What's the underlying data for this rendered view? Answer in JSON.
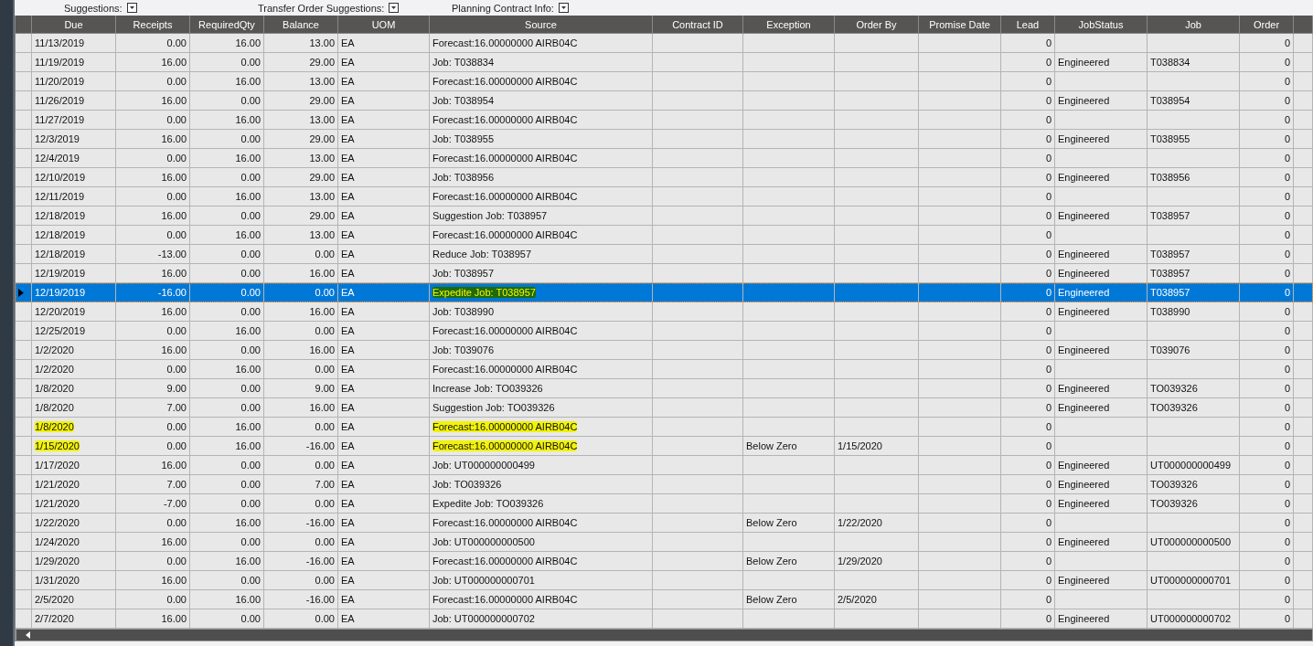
{
  "top_bar": [
    {
      "label": "Suggestions:"
    },
    {
      "label": "Transfer Order Suggestions:"
    },
    {
      "label": "Planning Contract Info:"
    }
  ],
  "table": {
    "columns": [
      {
        "label": "Due",
        "kind": "text"
      },
      {
        "label": "Receipts",
        "kind": "number"
      },
      {
        "label": "RequiredQty",
        "kind": "number"
      },
      {
        "label": "Balance",
        "kind": "number"
      },
      {
        "label": "UOM",
        "kind": "text"
      },
      {
        "label": "Source",
        "kind": "text"
      },
      {
        "label": "Contract ID",
        "kind": "text"
      },
      {
        "label": "Exception",
        "kind": "text"
      },
      {
        "label": "Order By",
        "kind": "text"
      },
      {
        "label": "Promise Date",
        "kind": "text"
      },
      {
        "label": "Lead",
        "kind": "number"
      },
      {
        "label": "JobStatus",
        "kind": "text"
      },
      {
        "label": "Job",
        "kind": "text"
      },
      {
        "label": "Order",
        "kind": "number"
      }
    ],
    "rows": [
      {
        "selected": false,
        "due_marked": false,
        "source_marked": false,
        "due": "11/13/2019",
        "receipts": "0.00",
        "required_qty": "16.00",
        "balance": "13.00",
        "uom": "EA",
        "source": "Forecast:16.00000000 AIRB04C",
        "lead": "0",
        "order": "0"
      },
      {
        "selected": false,
        "due_marked": false,
        "source_marked": false,
        "due": "11/19/2019",
        "receipts": "16.00",
        "required_qty": "0.00",
        "balance": "29.00",
        "uom": "EA",
        "source": "Job: T038834",
        "lead": "0",
        "job_status": "Engineered",
        "job": "T038834",
        "order": "0"
      },
      {
        "selected": false,
        "due_marked": false,
        "source_marked": false,
        "due": "11/20/2019",
        "receipts": "0.00",
        "required_qty": "16.00",
        "balance": "13.00",
        "uom": "EA",
        "source": "Forecast:16.00000000 AIRB04C",
        "lead": "0",
        "order": "0"
      },
      {
        "selected": false,
        "due_marked": false,
        "source_marked": false,
        "due": "11/26/2019",
        "receipts": "16.00",
        "required_qty": "0.00",
        "balance": "29.00",
        "uom": "EA",
        "source": "Job: T038954",
        "lead": "0",
        "job_status": "Engineered",
        "job": "T038954",
        "order": "0"
      },
      {
        "selected": false,
        "due_marked": false,
        "source_marked": false,
        "due": "11/27/2019",
        "receipts": "0.00",
        "required_qty": "16.00",
        "balance": "13.00",
        "uom": "EA",
        "source": "Forecast:16.00000000 AIRB04C",
        "lead": "0",
        "order": "0"
      },
      {
        "selected": false,
        "due_marked": false,
        "source_marked": false,
        "due": "12/3/2019",
        "receipts": "16.00",
        "required_qty": "0.00",
        "balance": "29.00",
        "uom": "EA",
        "source": "Job: T038955",
        "lead": "0",
        "job_status": "Engineered",
        "job": "T038955",
        "order": "0"
      },
      {
        "selected": false,
        "due_marked": false,
        "source_marked": false,
        "due": "12/4/2019",
        "receipts": "0.00",
        "required_qty": "16.00",
        "balance": "13.00",
        "uom": "EA",
        "source": "Forecast:16.00000000 AIRB04C",
        "lead": "0",
        "order": "0"
      },
      {
        "selected": false,
        "due_marked": false,
        "source_marked": false,
        "due": "12/10/2019",
        "receipts": "16.00",
        "required_qty": "0.00",
        "balance": "29.00",
        "uom": "EA",
        "source": "Job: T038956",
        "lead": "0",
        "job_status": "Engineered",
        "job": "T038956",
        "order": "0"
      },
      {
        "selected": false,
        "due_marked": false,
        "source_marked": false,
        "due": "12/11/2019",
        "receipts": "0.00",
        "required_qty": "16.00",
        "balance": "13.00",
        "uom": "EA",
        "source": "Forecast:16.00000000 AIRB04C",
        "lead": "0",
        "order": "0"
      },
      {
        "selected": false,
        "due_marked": false,
        "source_marked": false,
        "due": "12/18/2019",
        "receipts": "16.00",
        "required_qty": "0.00",
        "balance": "29.00",
        "uom": "EA",
        "source": "Suggestion Job: T038957",
        "lead": "0",
        "job_status": "Engineered",
        "job": "T038957",
        "order": "0"
      },
      {
        "selected": false,
        "due_marked": false,
        "source_marked": false,
        "due": "12/18/2019",
        "receipts": "0.00",
        "required_qty": "16.00",
        "balance": "13.00",
        "uom": "EA",
        "source": "Forecast:16.00000000 AIRB04C",
        "lead": "0",
        "order": "0"
      },
      {
        "selected": false,
        "due_marked": false,
        "source_marked": false,
        "due": "12/18/2019",
        "receipts": "-13.00",
        "required_qty": "0.00",
        "balance": "0.00",
        "uom": "EA",
        "source": "Reduce Job: T038957",
        "lead": "0",
        "job_status": "Engineered",
        "job": "T038957",
        "order": "0"
      },
      {
        "selected": false,
        "due_marked": false,
        "source_marked": false,
        "due": "12/19/2019",
        "receipts": "16.00",
        "required_qty": "0.00",
        "balance": "16.00",
        "uom": "EA",
        "source": "Job: T038957",
        "lead": "0",
        "job_status": "Engineered",
        "job": "T038957",
        "order": "0"
      },
      {
        "selected": true,
        "due_marked": false,
        "source_marked": true,
        "due": "12/19/2019",
        "receipts": "-16.00",
        "required_qty": "0.00",
        "balance": "0.00",
        "uom": "EA",
        "source": "Expedite Job: T038957",
        "lead": "0",
        "job_status": "Engineered",
        "job": "T038957",
        "order": "0"
      },
      {
        "selected": false,
        "due_marked": false,
        "source_marked": false,
        "due": "12/20/2019",
        "receipts": "16.00",
        "required_qty": "0.00",
        "balance": "16.00",
        "uom": "EA",
        "source": "Job: T038990",
        "lead": "0",
        "job_status": "Engineered",
        "job": "T038990",
        "order": "0"
      },
      {
        "selected": false,
        "due_marked": false,
        "source_marked": false,
        "due": "12/25/2019",
        "receipts": "0.00",
        "required_qty": "16.00",
        "balance": "0.00",
        "uom": "EA",
        "source": "Forecast:16.00000000 AIRB04C",
        "lead": "0",
        "order": "0"
      },
      {
        "selected": false,
        "due_marked": false,
        "source_marked": false,
        "due": "1/2/2020",
        "receipts": "16.00",
        "required_qty": "0.00",
        "balance": "16.00",
        "uom": "EA",
        "source": "Job: T039076",
        "lead": "0",
        "job_status": "Engineered",
        "job": "T039076",
        "order": "0"
      },
      {
        "selected": false,
        "due_marked": false,
        "source_marked": false,
        "due": "1/2/2020",
        "receipts": "0.00",
        "required_qty": "16.00",
        "balance": "0.00",
        "uom": "EA",
        "source": "Forecast:16.00000000 AIRB04C",
        "lead": "0",
        "order": "0"
      },
      {
        "selected": false,
        "due_marked": false,
        "source_marked": false,
        "due": "1/8/2020",
        "receipts": "9.00",
        "required_qty": "0.00",
        "balance": "9.00",
        "uom": "EA",
        "source": "Increase Job: TO039326",
        "lead": "0",
        "job_status": "Engineered",
        "job": "TO039326",
        "order": "0"
      },
      {
        "selected": false,
        "due_marked": false,
        "source_marked": false,
        "due": "1/8/2020",
        "receipts": "7.00",
        "required_qty": "0.00",
        "balance": "16.00",
        "uom": "EA",
        "source": "Suggestion Job: TO039326",
        "lead": "0",
        "job_status": "Engineered",
        "job": "TO039326",
        "order": "0"
      },
      {
        "selected": false,
        "due_marked": true,
        "source_marked": true,
        "due": "1/8/2020",
        "receipts": "0.00",
        "required_qty": "16.00",
        "balance": "0.00",
        "uom": "EA",
        "source": "Forecast:16.00000000 AIRB04C",
        "lead": "0",
        "order": "0"
      },
      {
        "selected": false,
        "due_marked": true,
        "source_marked": true,
        "due": "1/15/2020",
        "receipts": "0.00",
        "required_qty": "16.00",
        "balance": "-16.00",
        "uom": "EA",
        "source": "Forecast:16.00000000 AIRB04C",
        "exception": "Below Zero",
        "order_by": "1/15/2020",
        "lead": "0",
        "order": "0"
      },
      {
        "selected": false,
        "due_marked": false,
        "source_marked": false,
        "due": "1/17/2020",
        "receipts": "16.00",
        "required_qty": "0.00",
        "balance": "0.00",
        "uom": "EA",
        "source": "Job: UT000000000499",
        "lead": "0",
        "job_status": "Engineered",
        "job": "UT000000000499",
        "order": "0"
      },
      {
        "selected": false,
        "due_marked": false,
        "source_marked": false,
        "due": "1/21/2020",
        "receipts": "7.00",
        "required_qty": "0.00",
        "balance": "7.00",
        "uom": "EA",
        "source": "Job: TO039326",
        "lead": "0",
        "job_status": "Engineered",
        "job": "TO039326",
        "order": "0"
      },
      {
        "selected": false,
        "due_marked": false,
        "source_marked": false,
        "due": "1/21/2020",
        "receipts": "-7.00",
        "required_qty": "0.00",
        "balance": "0.00",
        "uom": "EA",
        "source": "Expedite Job: TO039326",
        "lead": "0",
        "job_status": "Engineered",
        "job": "TO039326",
        "order": "0"
      },
      {
        "selected": false,
        "due_marked": false,
        "source_marked": false,
        "due": "1/22/2020",
        "receipts": "0.00",
        "required_qty": "16.00",
        "balance": "-16.00",
        "uom": "EA",
        "source": "Forecast:16.00000000 AIRB04C",
        "exception": "Below Zero",
        "order_by": "1/22/2020",
        "lead": "0",
        "order": "0"
      },
      {
        "selected": false,
        "due_marked": false,
        "source_marked": false,
        "due": "1/24/2020",
        "receipts": "16.00",
        "required_qty": "0.00",
        "balance": "0.00",
        "uom": "EA",
        "source": "Job: UT000000000500",
        "lead": "0",
        "job_status": "Engineered",
        "job": "UT000000000500",
        "order": "0"
      },
      {
        "selected": false,
        "due_marked": false,
        "source_marked": false,
        "due": "1/29/2020",
        "receipts": "0.00",
        "required_qty": "16.00",
        "balance": "-16.00",
        "uom": "EA",
        "source": "Forecast:16.00000000 AIRB04C",
        "exception": "Below Zero",
        "order_by": "1/29/2020",
        "lead": "0",
        "order": "0"
      },
      {
        "selected": false,
        "due_marked": false,
        "source_marked": false,
        "due": "1/31/2020",
        "receipts": "16.00",
        "required_qty": "0.00",
        "balance": "0.00",
        "uom": "EA",
        "source": "Job: UT000000000701",
        "lead": "0",
        "job_status": "Engineered",
        "job": "UT000000000701",
        "order": "0"
      },
      {
        "selected": false,
        "due_marked": false,
        "source_marked": false,
        "due": "2/5/2020",
        "receipts": "0.00",
        "required_qty": "16.00",
        "balance": "-16.00",
        "uom": "EA",
        "source": "Forecast:16.00000000 AIRB04C",
        "exception": "Below Zero",
        "order_by": "2/5/2020",
        "lead": "0",
        "order": "0"
      },
      {
        "selected": false,
        "due_marked": false,
        "source_marked": false,
        "due": "2/7/2020",
        "receipts": "16.00",
        "required_qty": "0.00",
        "balance": "0.00",
        "uom": "EA",
        "source": "Job: UT000000000702",
        "lead": "0",
        "job_status": "Engineered",
        "job": "UT000000000702",
        "order": "0"
      }
    ]
  }
}
